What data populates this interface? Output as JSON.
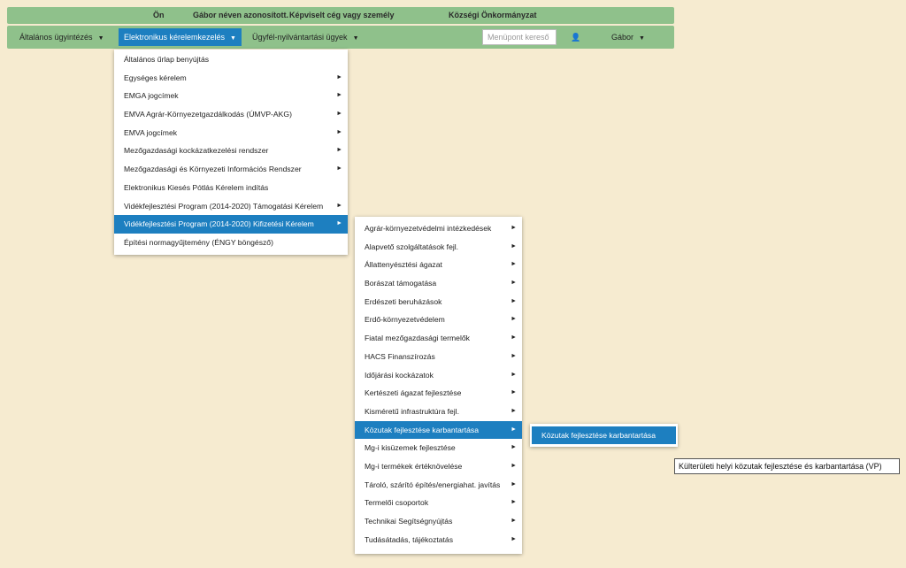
{
  "topbar": {
    "you": "Ön",
    "identity": "Gábor néven azonosított.",
    "represented_label": "Képviselt cég vagy személy",
    "represented_value": "Községi Önkormányzat"
  },
  "nav": {
    "items": [
      {
        "label": "Általános ügyintézés"
      },
      {
        "label": "Elektronikus kérelemkezelés"
      },
      {
        "label": "Ügyfél-nyilvántartási ügyek"
      }
    ],
    "search_placeholder": "Menüpont kereső",
    "user_name": "Gábor",
    "caret": "▼",
    "user_icon": "👤"
  },
  "menu1": [
    {
      "label": "Általános űrlap benyújtás",
      "sub": false
    },
    {
      "label": "Egységes kérelem",
      "sub": true
    },
    {
      "label": "EMGA jogcímek",
      "sub": true
    },
    {
      "label": "EMVA Agrár-Környezetgazdálkodás (ÚMVP-AKG)",
      "sub": true
    },
    {
      "label": "EMVA jogcímek",
      "sub": true
    },
    {
      "label": "Mezőgazdasági kockázatkezelési rendszer",
      "sub": true
    },
    {
      "label": "Mezőgazdasági és Környezeti Információs Rendszer",
      "sub": true
    },
    {
      "label": "Elektronikus Kiesés Pótlás Kérelem indítás",
      "sub": false
    },
    {
      "label": "Vidékfejlesztési Program (2014-2020) Támogatási Kérelem",
      "sub": true
    },
    {
      "label": "Vidékfejlesztési Program (2014-2020) Kifizetési Kérelem",
      "sub": true
    },
    {
      "label": "Építési normagyűjtemény (ÉNGY böngésző)",
      "sub": false
    }
  ],
  "menu2": [
    {
      "label": "Agrár-környezetvédelmi intézkedések"
    },
    {
      "label": "Alapvető szolgáltatások fejl."
    },
    {
      "label": "Állattenyésztési ágazat"
    },
    {
      "label": "Borászat támogatása"
    },
    {
      "label": "Erdészeti beruházások"
    },
    {
      "label": "Erdő-környezetvédelem"
    },
    {
      "label": "Fiatal mezőgazdasági termelők"
    },
    {
      "label": "HACS Finanszírozás"
    },
    {
      "label": "Időjárási kockázatok"
    },
    {
      "label": "Kertészeti ágazat fejlesztése"
    },
    {
      "label": "Kisméretű infrastruktúra fejl."
    },
    {
      "label": "Közutak fejlesztése karbantartása"
    },
    {
      "label": "Mg-i kisüzemek fejlesztése"
    },
    {
      "label": "Mg-i termékek értéknövelése"
    },
    {
      "label": "Tároló, szárító építés/energiahat. javítás"
    },
    {
      "label": "Termelői csoportok"
    },
    {
      "label": "Technikai Segítségnyújtás"
    },
    {
      "label": "Tudásátadás, tájékoztatás"
    }
  ],
  "menu3": [
    {
      "label": "Közutak fejlesztése karbantartása"
    }
  ],
  "tooltip": "Külterületi helyi közutak fejlesztése és karbantartása (VP)",
  "arrow": "►",
  "colors": {
    "background": "#f6ebd0",
    "bar": "#8fc18b",
    "accent": "#1d7fc0"
  }
}
